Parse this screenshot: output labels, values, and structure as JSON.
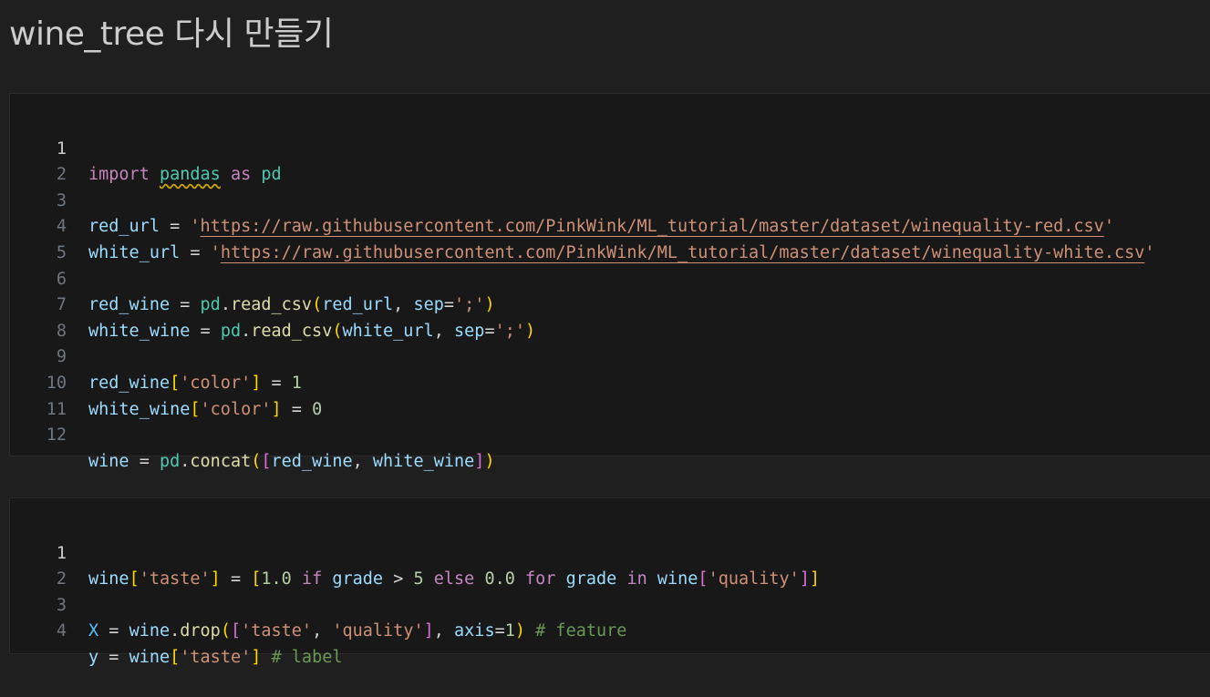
{
  "markdown": {
    "title": "wine_tree 다시 만들기"
  },
  "cells": [
    {
      "line_numbers": [
        "1",
        "2",
        "3",
        "4",
        "5",
        "6",
        "7",
        "8",
        "9",
        "10",
        "11",
        "12"
      ],
      "tokens": {
        "l1": [
          "import",
          "pandas",
          "as",
          "pd"
        ],
        "l3": [
          "red_url",
          "=",
          "'",
          "https://raw.githubusercontent.com/PinkWink/ML_tutorial/master/dataset/winequality-red.csv",
          "'"
        ],
        "l4": [
          "white_url",
          "=",
          "'",
          "https://raw.githubusercontent.com/PinkWink/ML_tutorial/master/dataset/winequality-white.csv",
          "'"
        ],
        "l6": [
          "red_wine",
          "=",
          "pd",
          ".",
          "read_csv",
          "(",
          "red_url",
          ", ",
          "sep",
          "=",
          "';'",
          ")"
        ],
        "l7": [
          "white_wine",
          "=",
          "pd",
          ".",
          "read_csv",
          "(",
          "white_url",
          ", ",
          "sep",
          "=",
          "';'",
          ")"
        ],
        "l9": [
          "red_wine",
          "[",
          "'color'",
          "]",
          "=",
          "1"
        ],
        "l10": [
          "white_wine",
          "[",
          "'color'",
          "]",
          "=",
          "0"
        ],
        "l12": [
          "wine",
          "=",
          "pd",
          ".",
          "concat",
          "(",
          "[",
          "red_wine",
          ", ",
          "white_wine",
          "]",
          ")"
        ]
      }
    },
    {
      "line_numbers": [
        "1",
        "2",
        "3",
        "4"
      ],
      "tokens": {
        "l1": [
          "wine",
          "[",
          "'taste'",
          "]",
          "=",
          "[",
          "1.0",
          "if",
          "grade",
          ">",
          "5",
          "else",
          "0.0",
          "for",
          "grade",
          "in",
          "wine",
          "[",
          "'quality'",
          "]",
          "]"
        ],
        "l3": [
          "X",
          "=",
          "wine",
          ".",
          "drop",
          "(",
          "[",
          "'taste'",
          ", ",
          "'quality'",
          "]",
          ", ",
          "axis",
          "=",
          "1",
          ")",
          "# feature"
        ],
        "l4": [
          "y",
          "=",
          "wine",
          "[",
          "'taste'",
          "]",
          "# label"
        ]
      }
    }
  ]
}
